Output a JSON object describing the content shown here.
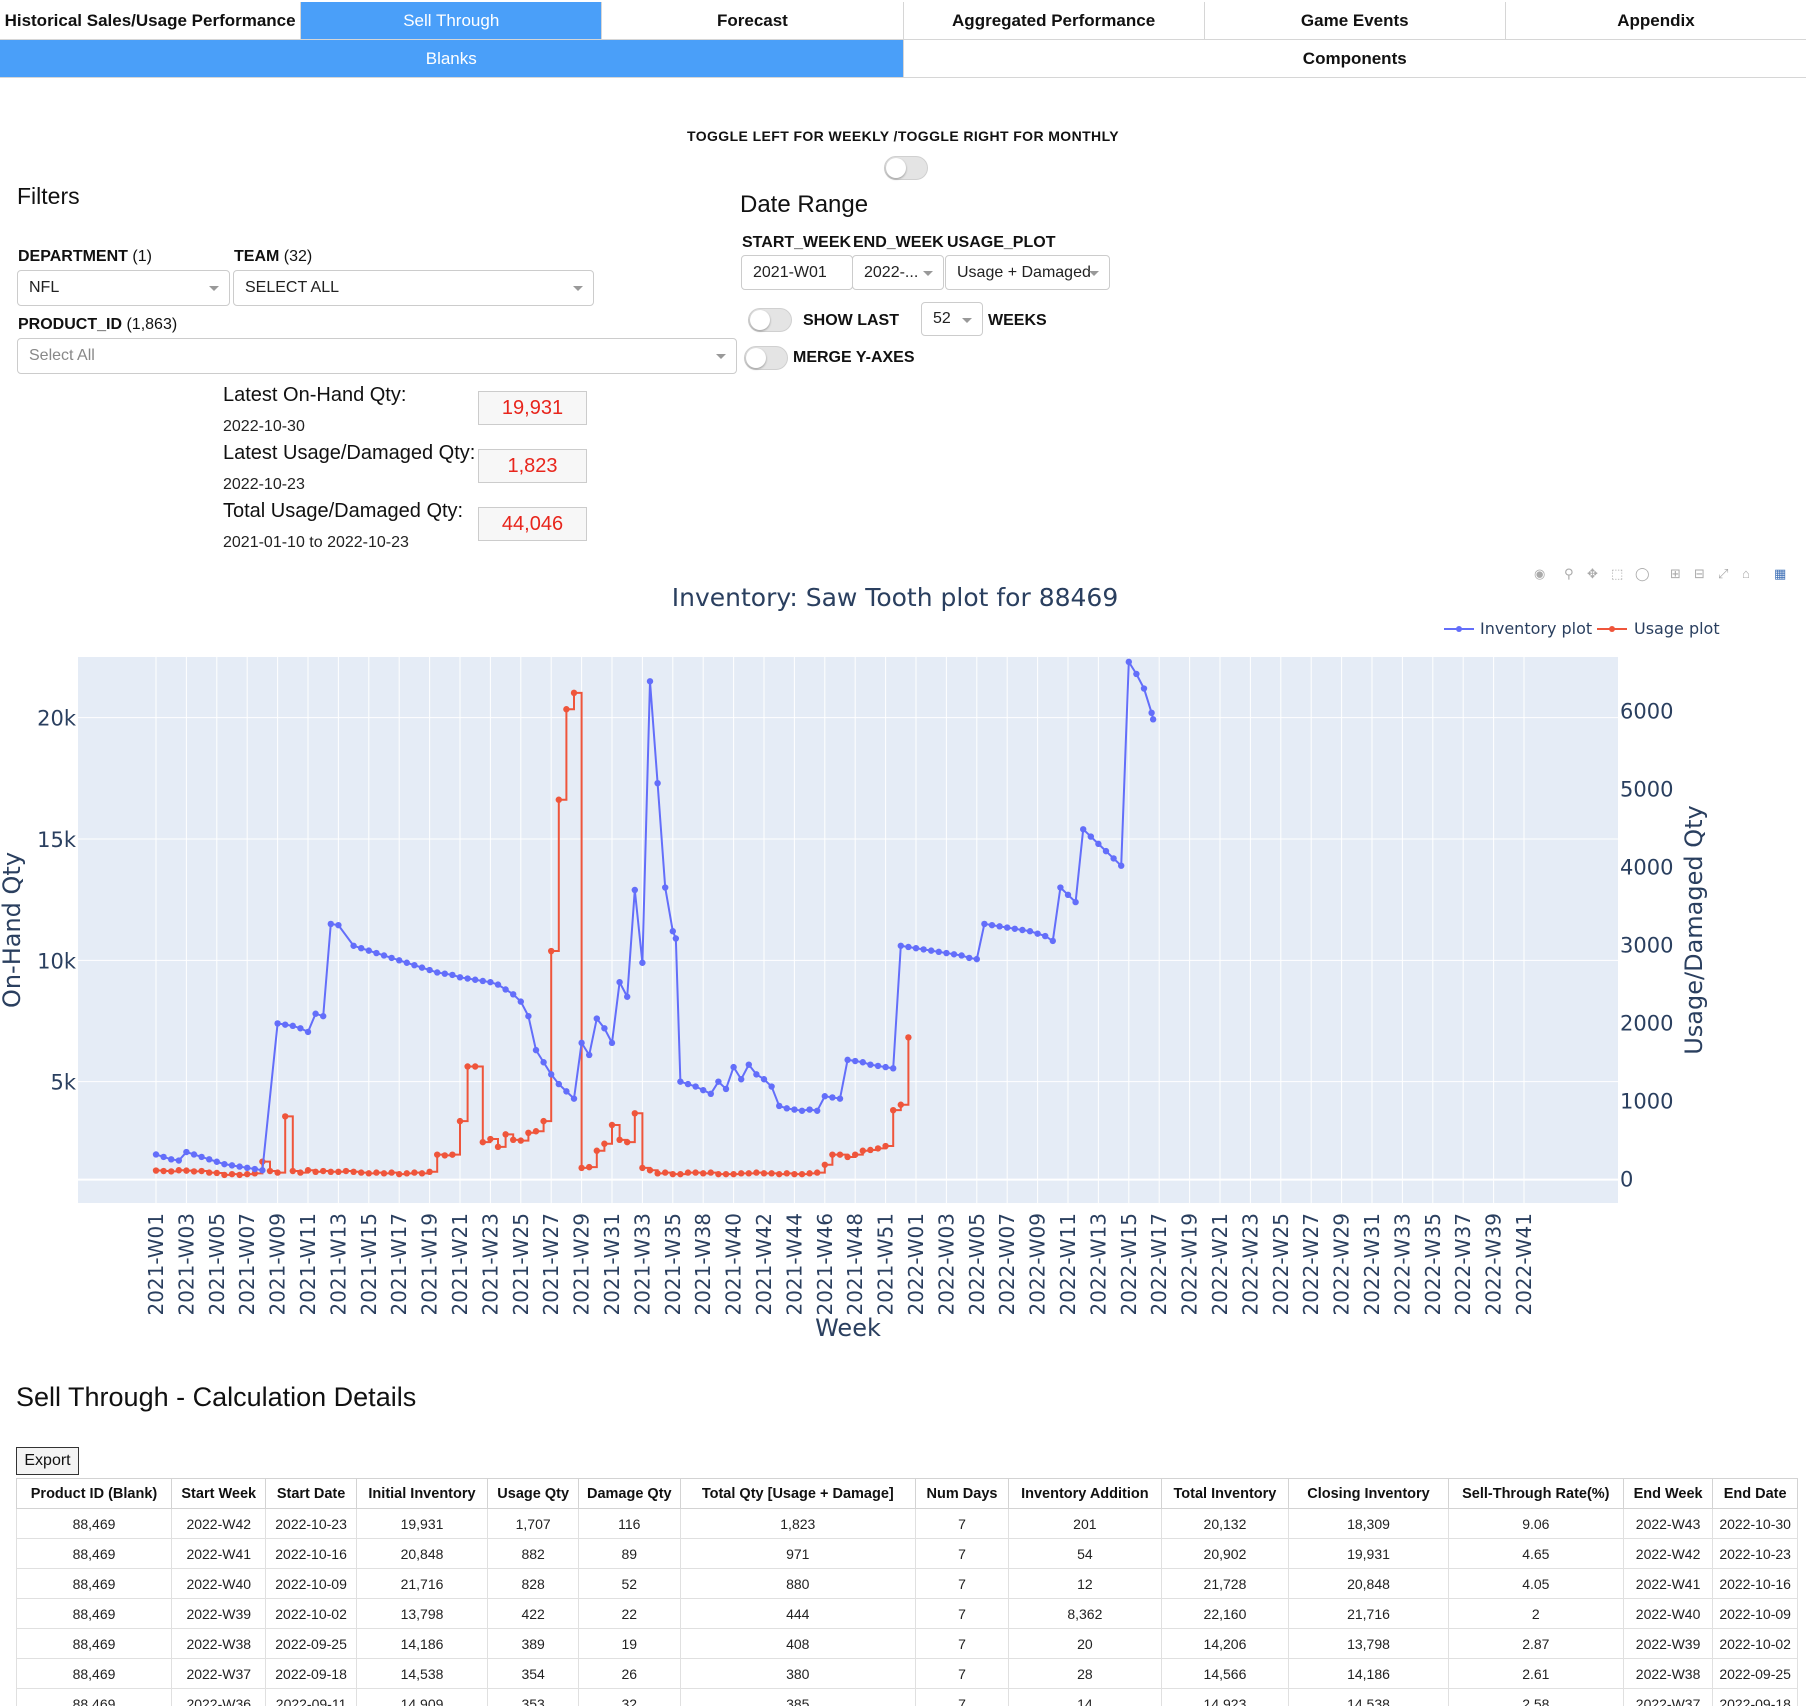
{
  "nav": {
    "tabs": [
      "Historical Sales/Usage Performance",
      "Sell Through",
      "Forecast",
      "Aggregated Performance",
      "Game Events",
      "Appendix"
    ],
    "active": 1,
    "subtabs": [
      "Blanks",
      "Components"
    ],
    "active_sub": 0
  },
  "toggle_title": "TOGGLE LEFT FOR WEEKLY /TOGGLE RIGHT FOR MONTHLY",
  "filters": {
    "heading": "Filters",
    "department_label": "DEPARTMENT",
    "department_count": "(1)",
    "department_value": "NFL",
    "team_label": "TEAM",
    "team_count": "(32)",
    "team_value": "SELECT ALL",
    "product_label": "PRODUCT_ID",
    "product_count": "(1,863)",
    "product_placeholder": "Select All"
  },
  "date_range": {
    "heading": "Date Range",
    "start_label": "START_WEEK",
    "end_label": "END_WEEK",
    "usage_label": "USAGE_PLOT",
    "start_value": "2021-W01",
    "end_value": "2022-...",
    "usage_value": "Usage + Damaged",
    "show_last_label": "SHOW LAST",
    "show_last_value": "52",
    "weeks_label": "WEEKS",
    "merge_label": "MERGE Y-AXES"
  },
  "kpis": [
    {
      "label": "Latest On-Hand Qty:",
      "sub": "2022-10-30",
      "value": "19,931"
    },
    {
      "label": "Latest Usage/Damaged Qty:",
      "sub": "2022-10-23",
      "value": "1,823"
    },
    {
      "label": "Total Usage/Damaged Qty:",
      "sub": "2021-01-10 to 2022-10-23",
      "value": "44,046"
    }
  ],
  "chart_data": {
    "type": "line",
    "title": "Inventory: Saw Tooth plot for 88469",
    "xlabel": "Week",
    "ylabel": "On-Hand Qty",
    "y2label": "Usage/Damaged Qty",
    "y_ticks": [
      5000,
      10000,
      15000,
      20000
    ],
    "y_tick_labels": [
      "5k",
      "10k",
      "15k",
      "20k"
    ],
    "y2_ticks": [
      0,
      1000,
      2000,
      3000,
      4000,
      5000,
      6000
    ],
    "ylim": [
      0,
      22500
    ],
    "y2lim": [
      -300,
      6700
    ],
    "legend_position": "top-right",
    "colors": {
      "inventory": "#636efa",
      "usage": "#ef553b",
      "plot_bg": "#e5ecf6",
      "axis_text": "#2a3f5f"
    },
    "x_tick_labels": [
      "2021-W01",
      "2021-W03",
      "2021-W05",
      "2021-W07",
      "2021-W09",
      "2021-W11",
      "2021-W13",
      "2021-W15",
      "2021-W17",
      "2021-W19",
      "2021-W21",
      "2021-W23",
      "2021-W25",
      "2021-W27",
      "2021-W29",
      "2021-W31",
      "2021-W33",
      "2021-W35",
      "2021-W38",
      "2021-W40",
      "2021-W42",
      "2021-W44",
      "2021-W46",
      "2021-W48",
      "2021-W51",
      "2022-W01",
      "2022-W03",
      "2022-W05",
      "2022-W07",
      "2022-W09",
      "2022-W11",
      "2022-W13",
      "2022-W15",
      "2022-W17",
      "2022-W19",
      "2022-W21",
      "2022-W23",
      "2022-W25",
      "2022-W27",
      "2022-W29",
      "2022-W31",
      "2022-W33",
      "2022-W35",
      "2022-W37",
      "2022-W39",
      "2022-W41"
    ],
    "series": [
      {
        "name": "Inventory plot",
        "axis": "y",
        "points": [
          [
            0,
            2000
          ],
          [
            0.5,
            1900
          ],
          [
            1,
            1800
          ],
          [
            1.5,
            1750
          ],
          [
            2,
            2100
          ],
          [
            2.5,
            2000
          ],
          [
            3,
            1900
          ],
          [
            3.5,
            1800
          ],
          [
            4,
            1700
          ],
          [
            4.5,
            1600
          ],
          [
            5,
            1550
          ],
          [
            5.5,
            1500
          ],
          [
            6,
            1450
          ],
          [
            6.5,
            1400
          ],
          [
            7,
            1350
          ],
          [
            8,
            7400
          ],
          [
            8.5,
            7350
          ],
          [
            9,
            7300
          ],
          [
            9.5,
            7200
          ],
          [
            10,
            7050
          ],
          [
            10.5,
            7800
          ],
          [
            11,
            7700
          ],
          [
            11.5,
            11500
          ],
          [
            12,
            11450
          ],
          [
            13,
            10600
          ],
          [
            13.5,
            10500
          ],
          [
            14,
            10400
          ],
          [
            14.5,
            10300
          ],
          [
            15,
            10200
          ],
          [
            15.5,
            10100
          ],
          [
            16,
            10000
          ],
          [
            16.5,
            9900
          ],
          [
            17,
            9800
          ],
          [
            17.5,
            9700
          ],
          [
            18,
            9600
          ],
          [
            18.5,
            9500
          ],
          [
            19,
            9450
          ],
          [
            19.5,
            9400
          ],
          [
            20,
            9300
          ],
          [
            20.5,
            9250
          ],
          [
            21,
            9200
          ],
          [
            21.5,
            9150
          ],
          [
            22,
            9100
          ],
          [
            22.5,
            9000
          ],
          [
            23,
            8800
          ],
          [
            23.5,
            8600
          ],
          [
            24,
            8300
          ],
          [
            24.5,
            7700
          ],
          [
            25,
            6300
          ],
          [
            25.5,
            5800
          ],
          [
            26,
            5300
          ],
          [
            26.5,
            4900
          ],
          [
            27,
            4600
          ],
          [
            27.5,
            4300
          ],
          [
            28,
            6600
          ],
          [
            28.5,
            6100
          ],
          [
            29,
            7600
          ],
          [
            29.5,
            7200
          ],
          [
            30,
            6600
          ],
          [
            30.5,
            9100
          ],
          [
            31,
            8500
          ],
          [
            31.5,
            12900
          ],
          [
            32,
            9900
          ],
          [
            32.5,
            21500
          ],
          [
            33,
            17300
          ],
          [
            33.5,
            13000
          ],
          [
            34,
            11200
          ],
          [
            34.2,
            10900
          ],
          [
            34.5,
            5000
          ],
          [
            35,
            4900
          ],
          [
            35.5,
            4800
          ],
          [
            36,
            4650
          ],
          [
            36.5,
            4500
          ],
          [
            37,
            5000
          ],
          [
            37.5,
            4700
          ],
          [
            38,
            5600
          ],
          [
            38.5,
            5100
          ],
          [
            39,
            5700
          ],
          [
            39.5,
            5300
          ],
          [
            40,
            5100
          ],
          [
            40.5,
            4800
          ],
          [
            41,
            4000
          ],
          [
            41.5,
            3900
          ],
          [
            42,
            3850
          ],
          [
            42.5,
            3800
          ],
          [
            43,
            3850
          ],
          [
            43.5,
            3800
          ],
          [
            44,
            4400
          ],
          [
            44.5,
            4350
          ],
          [
            45,
            4300
          ],
          [
            45.5,
            5900
          ],
          [
            46,
            5850
          ],
          [
            46.5,
            5800
          ],
          [
            47,
            5700
          ],
          [
            47.5,
            5650
          ],
          [
            48,
            5600
          ],
          [
            48.5,
            5550
          ],
          [
            49,
            10600
          ],
          [
            49.5,
            10550
          ],
          [
            50,
            10500
          ],
          [
            50.5,
            10450
          ],
          [
            51,
            10400
          ],
          [
            51.5,
            10350
          ],
          [
            52,
            10300
          ],
          [
            52.5,
            10250
          ],
          [
            53,
            10200
          ],
          [
            53.5,
            10100
          ],
          [
            54,
            10050
          ],
          [
            54.5,
            11500
          ],
          [
            55,
            11450
          ],
          [
            55.5,
            11400
          ],
          [
            56,
            11350
          ],
          [
            56.5,
            11300
          ],
          [
            57,
            11250
          ],
          [
            57.5,
            11200
          ],
          [
            58,
            11100
          ],
          [
            58.5,
            11000
          ],
          [
            59,
            10800
          ],
          [
            59.5,
            13000
          ],
          [
            60,
            12700
          ],
          [
            60.5,
            12400
          ],
          [
            61,
            15400
          ],
          [
            61.5,
            15100
          ],
          [
            62,
            14800
          ],
          [
            62.5,
            14500
          ],
          [
            63,
            14200
          ],
          [
            63.5,
            13900
          ],
          [
            64,
            22300
          ],
          [
            64.5,
            21800
          ],
          [
            65,
            21200
          ],
          [
            65.5,
            20200
          ],
          [
            65.6,
            19931
          ]
        ]
      },
      {
        "name": "Usage plot",
        "axis": "y2",
        "points": [
          [
            0,
            116
          ],
          [
            0.5,
            110
          ],
          [
            1,
            105
          ],
          [
            1.5,
            120
          ],
          [
            2,
            115
          ],
          [
            2.5,
            105
          ],
          [
            3,
            110
          ],
          [
            3.5,
            90
          ],
          [
            4,
            85
          ],
          [
            4.5,
            60
          ],
          [
            5,
            70
          ],
          [
            5.5,
            60
          ],
          [
            6,
            70
          ],
          [
            6.5,
            80
          ],
          [
            7,
            230
          ],
          [
            7.5,
            110
          ],
          [
            8,
            90
          ],
          [
            8.5,
            810
          ],
          [
            9,
            110
          ],
          [
            9.5,
            90
          ],
          [
            10,
            120
          ],
          [
            10.5,
            100
          ],
          [
            11,
            110
          ],
          [
            11.5,
            100
          ],
          [
            12,
            100
          ],
          [
            12.5,
            110
          ],
          [
            13,
            100
          ],
          [
            13.5,
            90
          ],
          [
            14,
            80
          ],
          [
            14.5,
            90
          ],
          [
            15,
            80
          ],
          [
            15.5,
            90
          ],
          [
            16,
            70
          ],
          [
            16.5,
            80
          ],
          [
            17,
            90
          ],
          [
            17.5,
            80
          ],
          [
            18,
            100
          ],
          [
            18.5,
            320
          ],
          [
            19,
            310
          ],
          [
            19.5,
            320
          ],
          [
            20,
            750
          ],
          [
            20.5,
            1450
          ],
          [
            21,
            1450
          ],
          [
            21.5,
            480
          ],
          [
            22,
            520
          ],
          [
            22.5,
            420
          ],
          [
            23,
            580
          ],
          [
            23.5,
            510
          ],
          [
            24,
            500
          ],
          [
            24.5,
            600
          ],
          [
            25,
            620
          ],
          [
            25.5,
            750
          ],
          [
            26,
            2930
          ],
          [
            26.5,
            4870
          ],
          [
            27,
            6030
          ],
          [
            27.5,
            6240
          ],
          [
            28,
            150
          ],
          [
            28.5,
            160
          ],
          [
            29,
            370
          ],
          [
            29.5,
            460
          ],
          [
            30,
            700
          ],
          [
            30.5,
            510
          ],
          [
            31,
            480
          ],
          [
            31.5,
            850
          ],
          [
            32,
            150
          ],
          [
            32.5,
            120
          ],
          [
            33,
            80
          ],
          [
            33.5,
            90
          ],
          [
            34,
            70
          ],
          [
            34.5,
            70
          ],
          [
            35,
            90
          ],
          [
            35.5,
            90
          ],
          [
            36,
            80
          ],
          [
            36.5,
            90
          ],
          [
            37,
            70
          ],
          [
            37.5,
            70
          ],
          [
            38,
            70
          ],
          [
            38.5,
            80
          ],
          [
            39,
            80
          ],
          [
            39.5,
            90
          ],
          [
            40,
            80
          ],
          [
            40.5,
            80
          ],
          [
            41,
            70
          ],
          [
            41.5,
            80
          ],
          [
            42,
            70
          ],
          [
            42.5,
            70
          ],
          [
            43,
            80
          ],
          [
            43.5,
            90
          ],
          [
            44,
            190
          ],
          [
            44.5,
            320
          ],
          [
            45,
            320
          ],
          [
            45.5,
            290
          ],
          [
            46,
            320
          ],
          [
            46.5,
            370
          ],
          [
            47,
            380
          ],
          [
            47.5,
            400
          ],
          [
            48,
            430
          ],
          [
            48.5,
            890
          ],
          [
            49,
            960
          ],
          [
            49.5,
            1823
          ]
        ]
      }
    ]
  },
  "details": {
    "heading": "Sell Through - Calculation Details",
    "export_label": "Export",
    "columns": [
      "Product ID (Blank)",
      "Start Week",
      "Start Date",
      "Initial Inventory",
      "Usage Qty",
      "Damage Qty",
      "Total Qty [Usage + Damage]",
      "Num Days",
      "Inventory Addition",
      "Total Inventory",
      "Closing Inventory",
      "Sell-Through Rate(%)",
      "End Week",
      "End Date"
    ],
    "rows": [
      [
        "88,469",
        "2022-W42",
        "2022-10-23",
        "19,931",
        "1,707",
        "116",
        "1,823",
        "7",
        "201",
        "20,132",
        "18,309",
        "9.06",
        "2022-W43",
        "2022-10-30"
      ],
      [
        "88,469",
        "2022-W41",
        "2022-10-16",
        "20,848",
        "882",
        "89",
        "971",
        "7",
        "54",
        "20,902",
        "19,931",
        "4.65",
        "2022-W42",
        "2022-10-23"
      ],
      [
        "88,469",
        "2022-W40",
        "2022-10-09",
        "21,716",
        "828",
        "52",
        "880",
        "7",
        "12",
        "21,728",
        "20,848",
        "4.05",
        "2022-W41",
        "2022-10-16"
      ],
      [
        "88,469",
        "2022-W39",
        "2022-10-02",
        "13,798",
        "422",
        "22",
        "444",
        "7",
        "8,362",
        "22,160",
        "21,716",
        "2",
        "2022-W40",
        "2022-10-09"
      ],
      [
        "88,469",
        "2022-W38",
        "2022-09-25",
        "14,186",
        "389",
        "19",
        "408",
        "7",
        "20",
        "14,206",
        "13,798",
        "2.87",
        "2022-W39",
        "2022-10-02"
      ],
      [
        "88,469",
        "2022-W37",
        "2022-09-18",
        "14,538",
        "354",
        "26",
        "380",
        "7",
        "28",
        "14,566",
        "14,186",
        "2.61",
        "2022-W38",
        "2022-09-25"
      ],
      [
        "88,469",
        "2022-W36",
        "2022-09-11",
        "14,909",
        "353",
        "32",
        "385",
        "7",
        "14",
        "14,923",
        "14,538",
        "2.58",
        "2022-W37",
        "2022-09-18"
      ]
    ]
  }
}
